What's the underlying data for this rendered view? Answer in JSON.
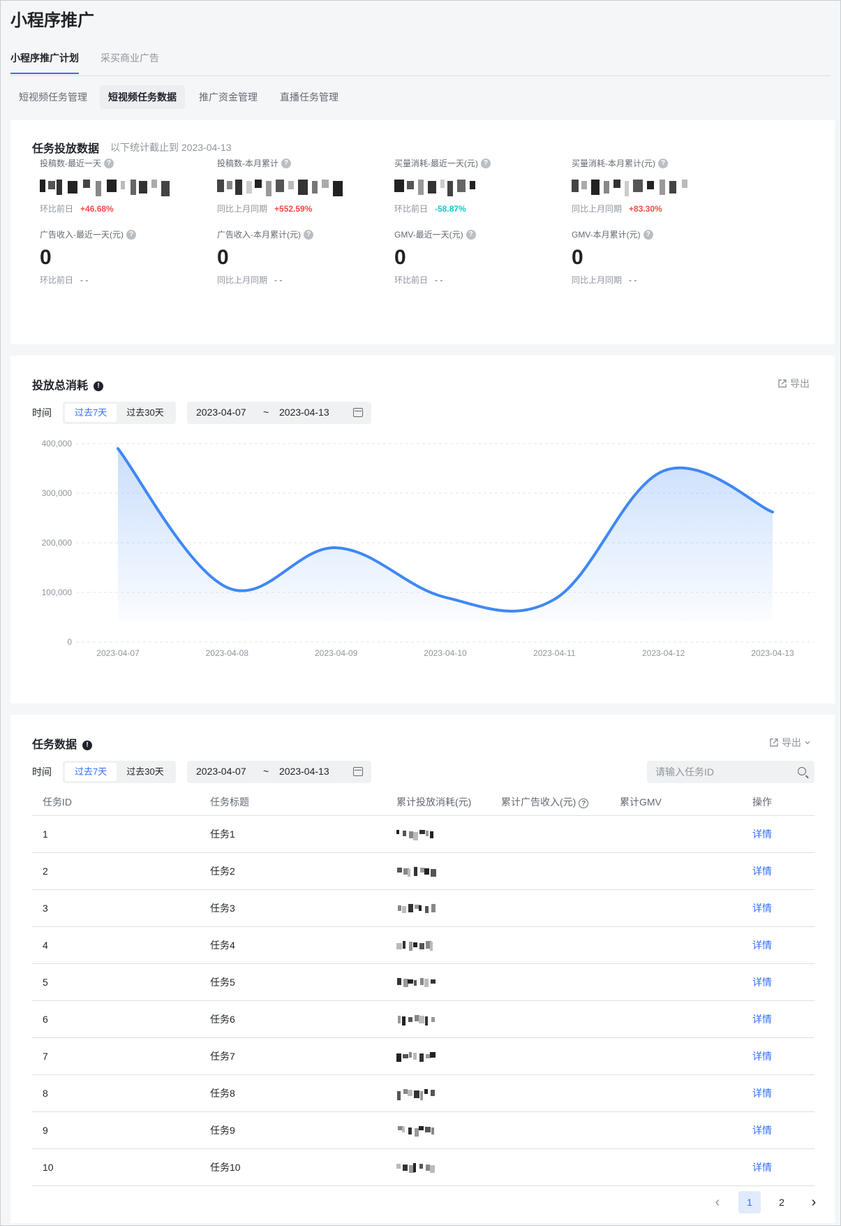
{
  "page": {
    "title": "小程序推广"
  },
  "tabs": [
    {
      "label": "小程序推广计划",
      "active": true
    },
    {
      "label": "采买商业广告",
      "active": false
    }
  ],
  "subtabs": [
    {
      "label": "短视频任务管理",
      "active": false
    },
    {
      "label": "短视频任务数据",
      "active": true
    },
    {
      "label": "推广资金管理",
      "active": false
    },
    {
      "label": "直播任务管理",
      "active": false
    }
  ],
  "overview": {
    "title": "任务投放数据",
    "subtitle": "以下统计截止到 2023-04-13",
    "stats": [
      {
        "label": "投稿数-最近一天",
        "value": "",
        "masked": true,
        "cmp_label": "环比前日",
        "cmp_value": "+46.68%",
        "trend": "up"
      },
      {
        "label": "投稿数-本月累计",
        "value": "",
        "masked": true,
        "cmp_label": "同比上月同期",
        "cmp_value": "+552.59%",
        "trend": "up"
      },
      {
        "label": "买量消耗-最近一天(元)",
        "value": "",
        "masked": true,
        "cmp_label": "环比前日",
        "cmp_value": "-58.87%",
        "trend": "down"
      },
      {
        "label": "买量消耗-本月累计(元)",
        "value": "",
        "masked": true,
        "cmp_label": "同比上月同期",
        "cmp_value": "+83.30%",
        "trend": "up"
      },
      {
        "label": "广告收入-最近一天(元)",
        "value": "0",
        "masked": false,
        "cmp_label": "环比前日",
        "cmp_value": "- -",
        "trend": "none"
      },
      {
        "label": "广告收入-本月累计(元)",
        "value": "0",
        "masked": false,
        "cmp_label": "同比上月同期",
        "cmp_value": "- -",
        "trend": "none"
      },
      {
        "label": "GMV-最近一天(元)",
        "value": "0",
        "masked": false,
        "cmp_label": "环比前日",
        "cmp_value": "- -",
        "trend": "none"
      },
      {
        "label": "GMV-本月累计(元)",
        "value": "0",
        "masked": false,
        "cmp_label": "同比上月同期",
        "cmp_value": "- -",
        "trend": "none"
      }
    ]
  },
  "spend": {
    "title": "投放总消耗",
    "export_label": "导出",
    "time_label": "时间",
    "range_options": [
      "过去7天",
      "过去30天"
    ],
    "range_selected": "过去7天",
    "date_start": "2023-04-07",
    "date_sep": "~",
    "date_end": "2023-04-13"
  },
  "chart_data": {
    "type": "area",
    "categories": [
      "2023-04-07",
      "2023-04-08",
      "2023-04-09",
      "2023-04-10",
      "2023-04-11",
      "2023-04-12",
      "2023-04-13"
    ],
    "series": [
      {
        "values": [
          390000,
          110000,
          190000,
          90000,
          86000,
          345000,
          262000
        ]
      }
    ],
    "ylim": [
      0,
      400000
    ],
    "yticks": [
      0,
      100000,
      200000,
      300000,
      400000
    ],
    "ytick_labels": [
      "0",
      "100,000",
      "200,000",
      "300,000",
      "400,000"
    ],
    "grid": true,
    "color": "#3f88f5"
  },
  "tasks": {
    "title": "任务数据",
    "export_label": "导出",
    "time_label": "时间",
    "range_options": [
      "过去7天",
      "过去30天"
    ],
    "range_selected": "过去7天",
    "date_start": "2023-04-07",
    "date_sep": "~",
    "date_end": "2023-04-13",
    "search_placeholder": "请输入任务ID",
    "columns": [
      "任务ID",
      "任务标题",
      "累计投放消耗(元)",
      "累计广告收入(元)",
      "累计GMV",
      "操作"
    ],
    "rows": [
      {
        "id": "1",
        "title": "任务1",
        "action": "详情"
      },
      {
        "id": "2",
        "title": "任务2",
        "action": "详情"
      },
      {
        "id": "3",
        "title": "任务3",
        "action": "详情"
      },
      {
        "id": "4",
        "title": "任务4",
        "action": "详情"
      },
      {
        "id": "5",
        "title": "任务5",
        "action": "详情"
      },
      {
        "id": "6",
        "title": "任务6",
        "action": "详情"
      },
      {
        "id": "7",
        "title": "任务7",
        "action": "详情"
      },
      {
        "id": "8",
        "title": "任务8",
        "action": "详情"
      },
      {
        "id": "9",
        "title": "任务9",
        "action": "详情"
      },
      {
        "id": "10",
        "title": "任务10",
        "action": "详情"
      }
    ],
    "pagination": {
      "pages": [
        "1",
        "2"
      ],
      "current": "1"
    }
  }
}
